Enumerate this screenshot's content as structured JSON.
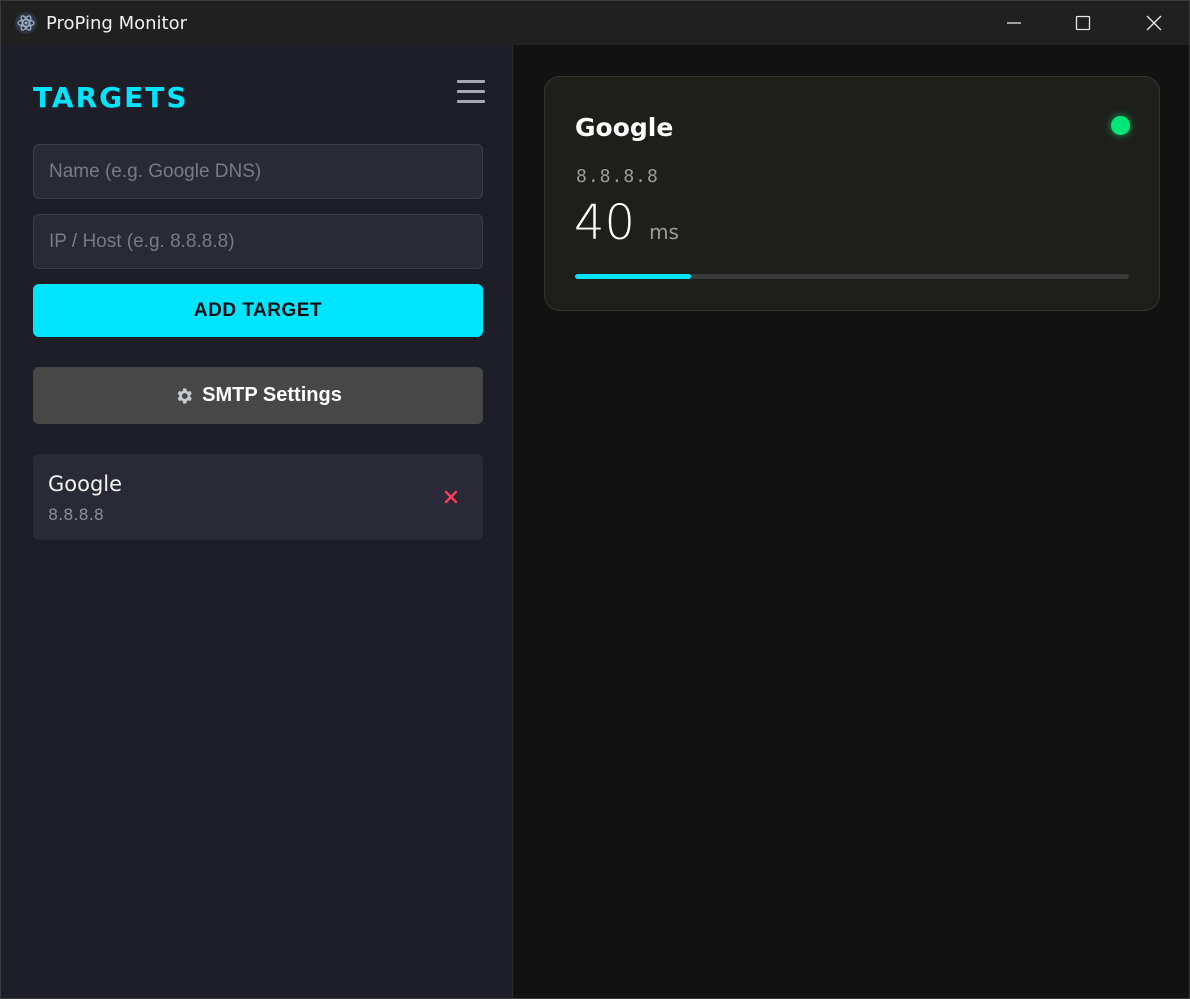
{
  "window": {
    "title": "ProPing Monitor",
    "icon": "electron-atom-icon",
    "controls": [
      "minimize-icon",
      "maximize-icon",
      "close-icon"
    ]
  },
  "sidebar": {
    "heading": "TARGETS",
    "menu_icon": "hamburger-menu-icon",
    "name_input": {
      "placeholder": "Name (e.g. Google DNS)",
      "value": ""
    },
    "host_input": {
      "placeholder": "IP / Host (e.g. 8.8.8.8)",
      "value": ""
    },
    "add_button_label": "ADD TARGET",
    "smtp_button": {
      "icon": "gear-icon",
      "label": "SMTP Settings"
    },
    "targets": [
      {
        "name": "Google",
        "host": "8.8.8.8",
        "remove_icon": "close-icon"
      }
    ]
  },
  "main": {
    "cards": [
      {
        "name": "Google",
        "host": "8.8.8.8",
        "status": "online",
        "latency_value": "40",
        "latency_unit": "ms",
        "latency_fraction": 0.21
      }
    ]
  },
  "colors": {
    "accent": "#00e5ff",
    "online": "#00e676",
    "remove": "#ff3b5c",
    "sidebar_bg": "#1e1e29",
    "main_bg": "#121212",
    "card_bg": "#1e1f1b"
  }
}
